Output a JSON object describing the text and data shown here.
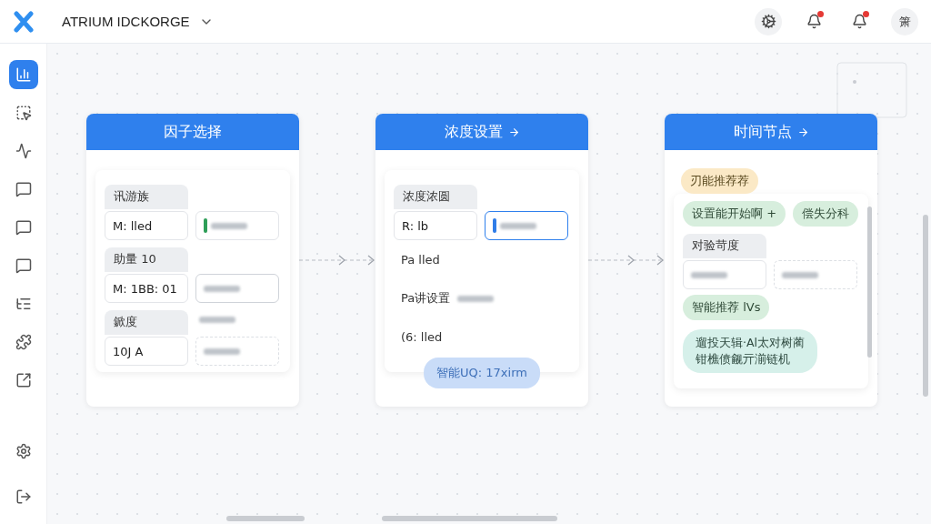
{
  "app": {
    "title": "ATRIUM IDCKORGE"
  },
  "toolbar": {
    "buttons": [
      {
        "kind": "gear"
      },
      {
        "kind": "bell",
        "badge": true
      },
      {
        "kind": "bell",
        "badge": true
      }
    ],
    "avatar": "箫"
  },
  "sidebar": {
    "items": [
      {
        "kind": "chart",
        "selected": true
      },
      {
        "kind": "square",
        "selected": false
      },
      {
        "kind": "wave",
        "selected": false
      },
      {
        "kind": "message",
        "selected": false
      },
      {
        "kind": "message",
        "selected": false
      },
      {
        "kind": "message",
        "selected": false
      },
      {
        "kind": "list",
        "selected": false
      },
      {
        "kind": "puzzle",
        "selected": false
      },
      {
        "kind": "export",
        "selected": false
      }
    ],
    "bottom": [
      {
        "kind": "gear",
        "selected": false
      },
      {
        "kind": "logout",
        "selected": false
      }
    ]
  },
  "cards": [
    {
      "title": "因子选择",
      "arrow": false,
      "items": [
        {
          "kind": "tab",
          "label": "讯游族"
        },
        {
          "kind": "fields",
          "value": "M: lled",
          "second": {
            "kind": "marker",
            "color": "#2e9e58"
          }
        },
        {
          "kind": "tab",
          "label": "助量 10"
        },
        {
          "kind": "fields",
          "value": "M: 1BB: 01",
          "second": {
            "kind": "plain"
          }
        },
        {
          "kind": "tab",
          "label": "鍁度",
          "blur_note": true
        },
        {
          "kind": "fields",
          "value": "10J A",
          "second": {
            "kind": "dashed"
          }
        }
      ]
    },
    {
      "title": "浓度设置",
      "arrow": true,
      "items": [
        {
          "kind": "tab",
          "label": "浓度浓圆"
        },
        {
          "kind": "fields",
          "value": "R: lb",
          "second": {
            "kind": "marker",
            "color": "#2f7de8",
            "focused": true
          }
        },
        {
          "kind": "line",
          "text": "Pa lled"
        },
        {
          "kind": "line",
          "text": "Pa讲设置",
          "blur_note": true
        },
        {
          "kind": "line",
          "text": "(6: lled"
        }
      ],
      "button": "智能UQ: 17xirm"
    },
    {
      "title": "时间节点",
      "arrow": true,
      "tag": "刃能推荐荐",
      "scrollable": true,
      "items": [
        {
          "kind": "chips",
          "chips": [
            "设置能开始啊 +",
            "偿失分科"
          ]
        },
        {
          "kind": "tab",
          "label": "对验苛度"
        },
        {
          "kind": "fields",
          "second": {
            "kind": "dashed"
          }
        },
        {
          "kind": "chips",
          "chips": [
            "智能推荐 lVs"
          ]
        },
        {
          "kind": "bubble",
          "lines": [
            "遛投天辑·Al太对树蔺",
            "钳樵偾觎亓湔链机"
          ]
        }
      ]
    }
  ]
}
